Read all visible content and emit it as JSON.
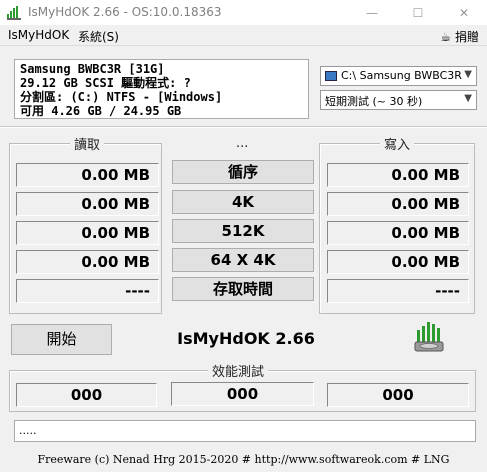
{
  "window": {
    "title": "IsMyHdOK 2.66 - OS:10.0.18363",
    "minimize": "—",
    "maximize": "☐",
    "close": "✕"
  },
  "menu": {
    "app": "IsMyHdOK",
    "system": "系統(S)",
    "donate": "捐贈"
  },
  "drive_info": {
    "line1": "Samsung BWBC3R [31G]",
    "line2": "29.12 GB  SCSI 驅動程式: ?",
    "line3": "分割區: (C:) NTFS - [Windows]",
    "line4": "可用 4.26 GB / 24.95 GB"
  },
  "drive_select": {
    "value": "C:\\ Samsung BWBC3R"
  },
  "test_select": {
    "value": "短期測試 (~ 30 秒)"
  },
  "read": {
    "label": "讀取",
    "values": [
      "0.00 MB",
      "0.00 MB",
      "0.00 MB",
      "0.00 MB",
      "----"
    ]
  },
  "middle": {
    "label": "...",
    "buttons": [
      "循序",
      "4K",
      "512K",
      "64 X 4K",
      "存取時間"
    ]
  },
  "write": {
    "label": "寫入",
    "values": [
      "0.00 MB",
      "0.00 MB",
      "0.00 MB",
      "0.00 MB",
      "----"
    ]
  },
  "start_button": "開始",
  "app_name": "IsMyHdOK 2.66",
  "performance": {
    "label": "效能測試",
    "scores": [
      "000",
      "000",
      "000"
    ]
  },
  "status": ".....",
  "footer": "Freeware (c) Nenad Hrg 2015-2020 # http://www.softwareok.com    # LNG",
  "colors": {
    "icon_green": "#2e9b2e",
    "icon_gray": "#9a9a9a"
  }
}
